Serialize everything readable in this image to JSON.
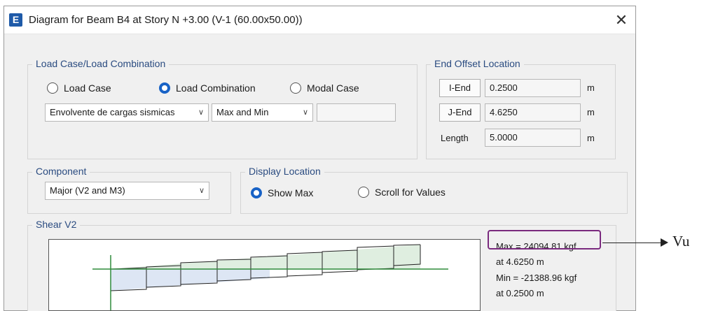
{
  "window": {
    "app_icon_letter": "E",
    "title": "Diagram for Beam B4 at Story N +3.00 (V-1 (60.00x50.00))",
    "close_glyph": "✕"
  },
  "load_case": {
    "legend": "Load Case/Load Combination",
    "options": [
      {
        "label": "Load Case",
        "selected": false
      },
      {
        "label": "Load Combination",
        "selected": true
      },
      {
        "label": "Modal Case",
        "selected": false
      }
    ],
    "combination_value": "Envolvente de cargas sismicas",
    "type_value": "Max and Min",
    "extra_value": ""
  },
  "end_offset": {
    "legend": "End Offset Location",
    "i_end_label": "I-End",
    "i_end_value": "0.2500",
    "j_end_label": "J-End",
    "j_end_value": "4.6250",
    "length_label": "Length",
    "length_value": "5.0000",
    "unit": "m"
  },
  "component": {
    "legend": "Component",
    "value": "Major (V2 and M3)"
  },
  "display_location": {
    "legend": "Display Location",
    "options": [
      {
        "label": "Show Max",
        "selected": true
      },
      {
        "label": "Scroll for Values",
        "selected": false
      }
    ]
  },
  "shear": {
    "legend": "Shear V2",
    "max_text": "Max = 24094.81 kgf",
    "max_at": "at 4.6250 m",
    "min_text": "Min = -21388.96 kgf",
    "min_at": "at 0.2500 m"
  },
  "annotation": {
    "label": "Vu",
    "highlight_color": "#7a2a7e"
  },
  "colors": {
    "accent": "#1862c6",
    "legend_text": "#2a4b80",
    "diagram_fill": "#dfeee0",
    "diagram_fill_negative": "#dde6f4",
    "axis_green": "#2e8b3a"
  }
}
